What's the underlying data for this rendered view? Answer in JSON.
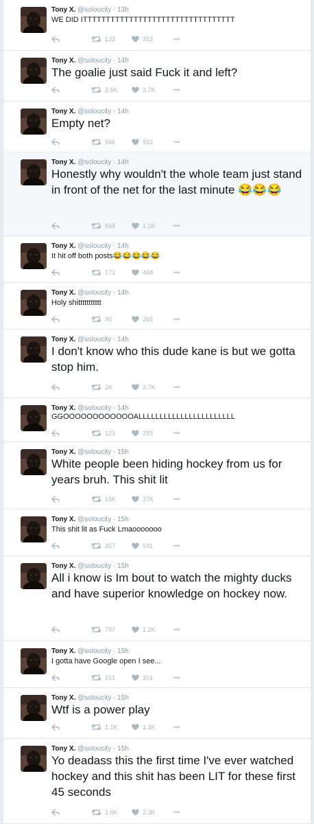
{
  "profile": {
    "name": "Tony X.",
    "handle": "@soloucity"
  },
  "icons": {
    "avatar": "avatar-photo",
    "reply": "reply-icon",
    "retweet": "retweet-icon",
    "like": "heart-icon",
    "more": "more-dots-icon"
  },
  "more_label": "•••",
  "colors": {
    "text": "#14171a",
    "muted": "#8899a6",
    "action": "#aab8c2",
    "divider": "#e1e8ed"
  },
  "tweets": [
    {
      "time": "13h",
      "text": "WE DID ITTTTTTTTTTTTTTTTTTTTTTTTTTTTTTTTT",
      "retweets": "133",
      "likes": "353"
    },
    {
      "time": "14h",
      "text": "The goalie just said Fuck it and left?",
      "retweets": "2.6K",
      "likes": "3.7K"
    },
    {
      "time": "14h",
      "text": "Empty net?",
      "retweets": "946",
      "likes": "932"
    },
    {
      "time": "14h",
      "text": "Honestly why wouldn't the whole team just stand in front of the net for the last minute 😂😂😂",
      "retweets": "668",
      "likes": "1.1K"
    },
    {
      "time": "14h",
      "text": "It hit off both posts😂😂😂😂😂",
      "retweets": "173",
      "likes": "468"
    },
    {
      "time": "14h",
      "text": "Holy shittttttttttt",
      "retweets": "90",
      "likes": "265"
    },
    {
      "time": "14h",
      "text": "I don't know who this dude kane is but we gotta stop him.",
      "retweets": "2K",
      "likes": "2.7K"
    },
    {
      "time": "14h",
      "text": "GGOOOOOOOOOOOOALLLLLLLLLLLLLLLLLLLLLLL",
      "retweets": "123",
      "likes": "293"
    },
    {
      "time": "15h",
      "text": "White people been hiding hockey from us for years bruh. This shit lit",
      "retweets": "19K",
      "likes": "27K"
    },
    {
      "time": "15h",
      "text": "This shit lit as Fuck Lmaooooooo",
      "retweets": "357",
      "likes": "591"
    },
    {
      "time": "15h",
      "text": "All i know is Im bout to watch the mighty ducks and have superior knowledge on hockey now.",
      "retweets": "797",
      "likes": "1.2K"
    },
    {
      "time": "15h",
      "text": "I gotta have Google open I see...",
      "retweets": "161",
      "likes": "301"
    },
    {
      "time": "15h",
      "text": "Wtf is a power play",
      "retweets": "1.1K",
      "likes": "1.3K"
    },
    {
      "time": "15h",
      "text": "Yo deadass this the first time I've ever watched hockey and this shit has been LIT for these first 45 seconds",
      "retweets": "1.6K",
      "likes": "2.3K"
    }
  ]
}
